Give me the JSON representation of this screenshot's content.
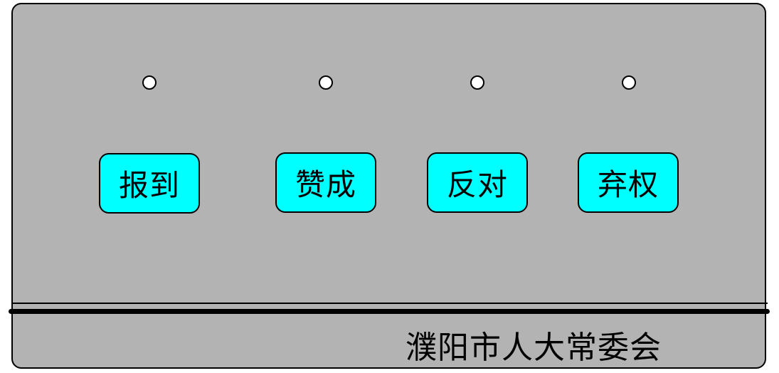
{
  "buttons": [
    {
      "id": "checkin",
      "label": "报到"
    },
    {
      "id": "approve",
      "label": "赞成"
    },
    {
      "id": "oppose",
      "label": "反对"
    },
    {
      "id": "abstain",
      "label": "弃权"
    }
  ],
  "colors": {
    "panel": "#b3b3b3",
    "button": "#00ffff",
    "indicator": "#ffffff",
    "outline": "#000000"
  },
  "footer": {
    "organization": "濮阳市人大常委会"
  }
}
